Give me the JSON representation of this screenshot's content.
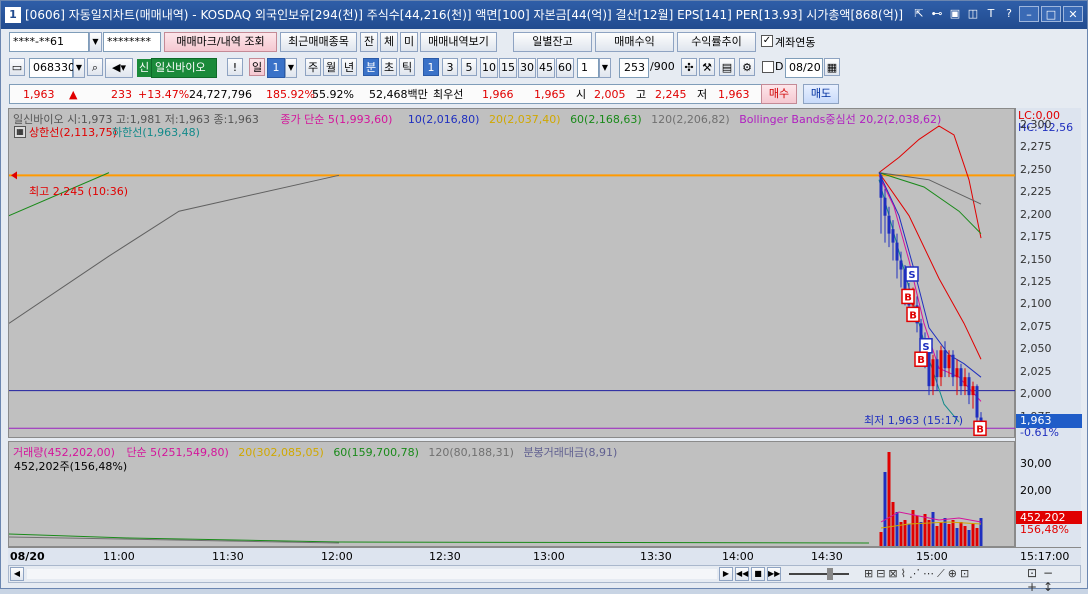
{
  "window": {
    "number": "1",
    "title": "[0606] 자동일지차트(매매내역) - KOSDAQ 외국인보유[294(천)] 주식수[44,216(천)] 액면[100] 자본금[44(억)] 결산[12월] EPS[141] PER[13.93] 시가총액[868(억)]"
  },
  "toolbar1": {
    "account": "****-**61",
    "password": "********",
    "btn_trade_mark": "매매마크/내역 조회",
    "btn_recent": "최근매매종목",
    "btn_jan": "잔",
    "btn_che": "체",
    "btn_mi": "미",
    "btn_trade_view": "매매내역보기",
    "btn_daily_balance": "일별잔고",
    "btn_trade_profit": "매매수익",
    "btn_yield": "수익률추이",
    "chk_account_link": "계좌연동"
  },
  "toolbar2": {
    "code": "068330",
    "badge_new": "신",
    "stock_name": "일신바이오",
    "btn_excl": "!",
    "btn_day": "일",
    "period_num": "1",
    "btn_week": "주",
    "btn_month": "월",
    "btn_year": "년",
    "btn_min": "분",
    "btn_sec": "초",
    "btn_tick": "틱",
    "intervals": [
      "1",
      "3",
      "5",
      "10",
      "15",
      "30",
      "45",
      "60"
    ],
    "interval_sel": "1",
    "count": "253",
    "count_max": "/900",
    "chk_d": "D",
    "date": "08/20"
  },
  "quote": {
    "price": "1,963",
    "arrow": "▲",
    "change": "233",
    "change_pct": "+13.47%",
    "volume": "24,727,796",
    "vol_ratio": "185.92%",
    "turnover": "55.92%",
    "amount": "52,468백만",
    "prefer_label": "최우선",
    "ask": "1,966",
    "bid": "1,965",
    "open_label": "시",
    "open": "2,005",
    "high_label": "고",
    "high": "2,245",
    "low_label": "저",
    "low": "1,963",
    "btn_buy": "매수",
    "btn_sell": "매도"
  },
  "chart_data": [
    {
      "type": "line",
      "title": "일신바이오 시:1,973 고:1,981 저:1,963 종:1,963",
      "legend": [
        {
          "name": "종가 단순 5(1,993,60)",
          "color": "#d4149b"
        },
        {
          "name": "10(2,016,80)",
          "color": "#1f2fbf"
        },
        {
          "name": "20(2,037,40)",
          "color": "#d0a800"
        },
        {
          "name": "60(2,168,63)",
          "color": "#1a8a1a"
        },
        {
          "name": "120(2,206,82)",
          "color": "#707070"
        },
        {
          "name": "Bollinger Bands중심선 20,2(2,038,62)",
          "color": "#b020c0"
        }
      ],
      "upper_limit_label": "상한선(2,113,75)",
      "lower_limit_label": "하한선(1,963,48)",
      "high_marker": "최고 2,245 (10:36)",
      "low_marker": "최저 1,963 (15:17)",
      "y_axis_ticks": [
        2300,
        2275,
        2250,
        2225,
        2200,
        2175,
        2150,
        2125,
        2100,
        2075,
        2050,
        2025,
        2000,
        1975
      ],
      "y_axis_labels": [
        "2,300",
        "2,275",
        "2,250",
        "2,225",
        "2,200",
        "2,175",
        "2,150",
        "2,125",
        "2,100",
        "2,075",
        "2,050",
        "2,025",
        "2,000",
        "1,975"
      ],
      "ylim": [
        1960,
        2310
      ],
      "current_price_label": "1,963",
      "current_pct_label": "-0.61%",
      "lc_label": "LC:0,00",
      "hc_label": "HC:-12,56",
      "horizontal_lines": [
        {
          "value": 2245,
          "color": "#ff9a00"
        },
        {
          "value": 2005,
          "color": "#2020a0"
        },
        {
          "value": 1963,
          "color": "#9a20c0"
        }
      ],
      "ma120_series": {
        "x": [
          "08:00",
          "09:30",
          "10:30",
          "11:00",
          "12:00"
        ],
        "y": [
          2080,
          2155,
          2205,
          2215,
          2245
        ]
      },
      "ma60_series": {
        "x": [
          "08:00",
          "09:30"
        ],
        "y": [
          2200,
          2248
        ]
      },
      "trade_marks": [
        {
          "label": "S",
          "price": 2135,
          "kind": "sell"
        },
        {
          "label": "B",
          "price": 2110,
          "kind": "buy"
        },
        {
          "label": "B",
          "price": 2090,
          "kind": "buy"
        },
        {
          "label": "S",
          "price": 2055,
          "kind": "sell"
        },
        {
          "label": "B",
          "price": 2040,
          "kind": "buy"
        },
        {
          "label": "B",
          "price": 1963,
          "kind": "buy"
        }
      ]
    },
    {
      "type": "bar",
      "title": "거래량(452,202,00)",
      "legend": [
        {
          "name": "단순 5(251,549,80)",
          "color": "#d4149b"
        },
        {
          "name": "20(302,085,05)",
          "color": "#d0a800"
        },
        {
          "name": "60(159,700,78)",
          "color": "#1a8a1a"
        },
        {
          "name": "120(80,188,31)",
          "color": "#707070"
        },
        {
          "name": "분봉거래대금(8,91)",
          "color": "#606090"
        }
      ],
      "sub_label": "452,202주(156,48%)",
      "y_axis_labels": [
        "30,00",
        "20,00"
      ],
      "current_label": "452,202",
      "current_pct": "156,48%"
    }
  ],
  "time_axis": {
    "date": "08/20",
    "ticks": [
      "11:00",
      "11:30",
      "12:00",
      "12:30",
      "13:00",
      "13:30",
      "14:00",
      "14:30",
      "15:00",
      "15:17:00"
    ]
  }
}
